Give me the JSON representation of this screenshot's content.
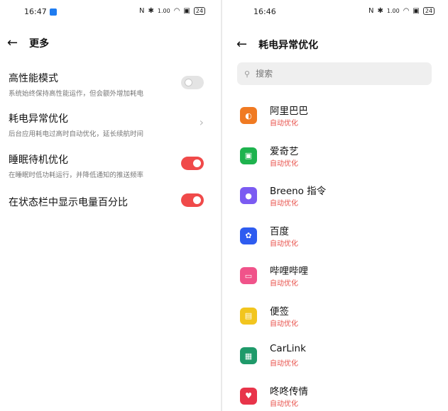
{
  "left": {
    "status": {
      "time": "16:47",
      "speed": "1.00",
      "battery": "24"
    },
    "nav": {
      "title": "更多"
    },
    "settings": [
      {
        "title": "高性能模式",
        "subtitle": "系统始终保持高性能运作，但会额外增加耗电",
        "control": "toggle-off"
      },
      {
        "title": "耗电异常优化",
        "subtitle": "后台应用耗电过高时自动优化，延长续航时间",
        "control": "chevron"
      },
      {
        "title": "睡眠待机优化",
        "subtitle": "在睡眠时低功耗运行，并降低通知的推送频率",
        "control": "toggle-on"
      },
      {
        "title": "在状态栏中显示电量百分比",
        "subtitle": "",
        "control": "toggle-on"
      }
    ]
  },
  "right": {
    "status": {
      "time": "16:46",
      "speed": "1.00",
      "battery": "24"
    },
    "nav": {
      "title": "耗电异常优化"
    },
    "search": {
      "placeholder": "搜索"
    },
    "apps": [
      {
        "name": "阿里巴巴",
        "status": "自动优化",
        "icon": "alibaba-icon",
        "color": "#f07a22"
      },
      {
        "name": "爱奇艺",
        "status": "自动优化",
        "icon": "iqiyi-icon",
        "color": "#1eb34e"
      },
      {
        "name": "Breeno 指令",
        "status": "自动优化",
        "icon": "breeno-icon",
        "color": "#7b5bf2"
      },
      {
        "name": "百度",
        "status": "自动优化",
        "icon": "baidu-icon",
        "color": "#2e5cf0"
      },
      {
        "name": "哔哩哔哩",
        "status": "自动优化",
        "icon": "bilibili-icon",
        "color": "#f0538a"
      },
      {
        "name": "便签",
        "status": "自动优化",
        "icon": "notes-icon",
        "color": "#f2c51e"
      },
      {
        "name": "CarLink",
        "status": "自动优化",
        "icon": "carlink-icon",
        "color": "#1f9a6a"
      },
      {
        "name": "咚咚传情",
        "status": "自动优化",
        "icon": "dongdong-icon",
        "color": "#e8344a"
      }
    ]
  },
  "colors": {
    "accent": "#f04a4a",
    "subtitle_red": "#e8504a"
  }
}
